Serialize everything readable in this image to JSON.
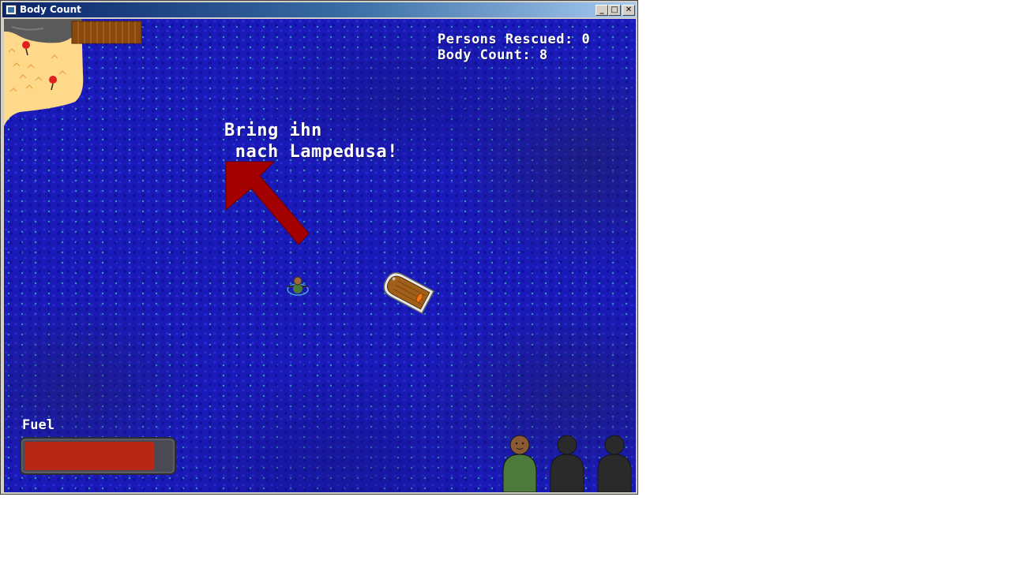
{
  "window": {
    "title": "Body Count",
    "minimize_glyph": "_",
    "maximize_glyph": "□",
    "close_glyph": "✕"
  },
  "hud": {
    "persons_rescued": "Persons Rescued: 0",
    "body_count": "Body Count: 8"
  },
  "hint": {
    "line1": "Bring ihn",
    "line2": " nach Lampedusa!",
    "arrow_color": "#a30000"
  },
  "fuel": {
    "label": "Fuel",
    "level_percent": 88,
    "fill_color": "#b62815"
  },
  "passengers": {
    "capacity": 3,
    "slots": [
      "filled",
      "empty",
      "empty"
    ],
    "filled_color": "#4b7a3a",
    "empty_color": "#2a2a2a"
  },
  "colors": {
    "water": "#1a1ab8",
    "sand": "#ffd98a",
    "rock": "#5a5a5a",
    "dock_wood": "#8a4a0f"
  },
  "sprites": {
    "island": "island-icon",
    "dock": "dock-icon",
    "arrow": "arrow-icon",
    "swimmer": "swimmer-icon",
    "boat": "boat-icon",
    "passenger": "person-icon"
  }
}
